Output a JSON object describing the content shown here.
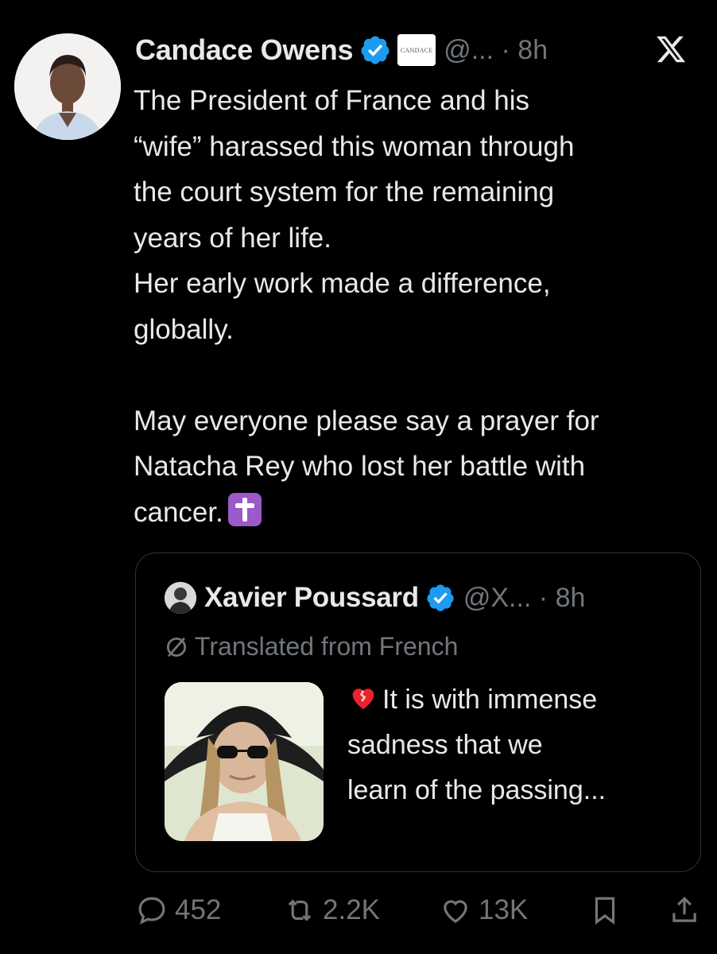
{
  "tweet": {
    "author_name": "Candace Owens",
    "affiliate_badge_text": "CANDACE",
    "handle": "@...",
    "time": "· 8h",
    "lines": [
      "The President of France and his",
      "“wife” harassed this woman through",
      "the court system for the remaining",
      "years of her life.",
      "Her early work made a difference,",
      "globally.",
      "",
      "May everyone please say a prayer for",
      "Natacha Rey who lost her battle with",
      "cancer."
    ],
    "emoji": "latin-cross-emoji"
  },
  "quote": {
    "author_name": "Xavier Poussard",
    "handle": "@X...",
    "time": "· 8h",
    "translated_label": "Translated from French",
    "lines": [
      "It is with immense",
      "sadness that we",
      "learn of the passing..."
    ],
    "emoji": "mending-heart-emoji"
  },
  "actions": {
    "replies": "452",
    "retweets": "2.2K",
    "likes": "13K"
  },
  "colors": {
    "background": "#000000",
    "text": "#e7e9ea",
    "muted": "#71767b",
    "verified": "#1d9bf0",
    "border": "#2f3336"
  }
}
